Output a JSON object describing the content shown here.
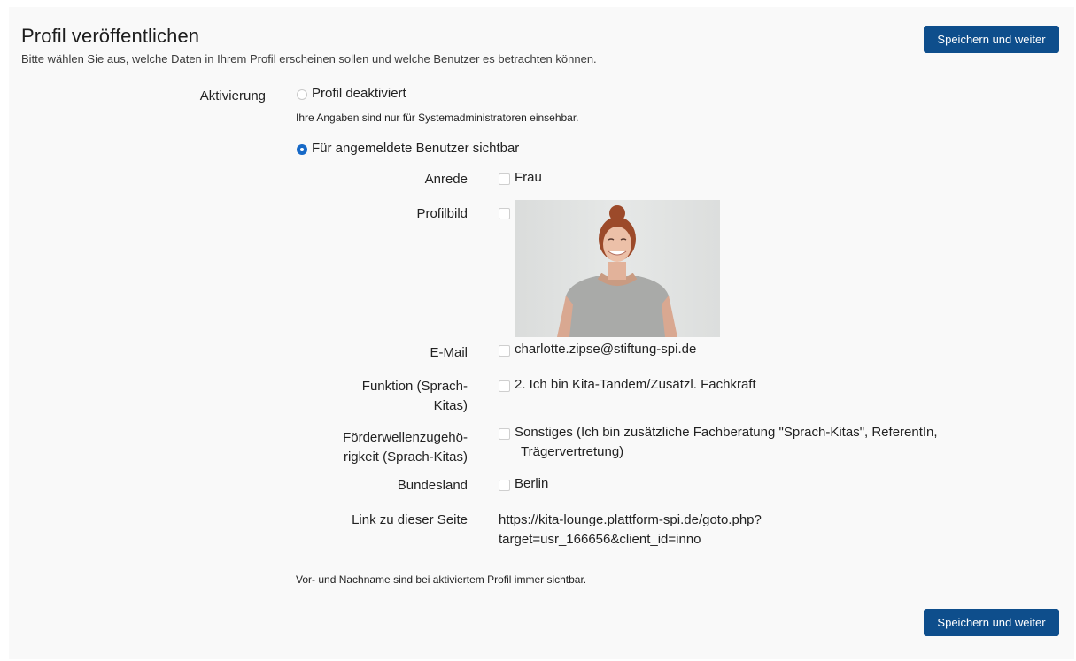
{
  "header": {
    "title": "Profil veröffentlichen",
    "subtitle": "Bitte wählen Sie aus, welche Daten in Ihrem Profil erscheinen sollen und welche Benutzer es betrachten können.",
    "save_label": "Speichern und weiter"
  },
  "activation": {
    "label": "Aktivierung",
    "option_disabled": "Profil deaktiviert",
    "option_disabled_info": "Ihre Angaben sind nur für Systemadministratoren einsehbar.",
    "option_visible": "Für angemeldete Benutzer sichtbar",
    "selected": "visible"
  },
  "fields": {
    "anrede": {
      "label": "Anrede",
      "value": "Frau"
    },
    "profilbild": {
      "label": "Profilbild"
    },
    "email": {
      "label": "E-Mail",
      "value": "charlotte.zipse@stiftung-spi.de"
    },
    "funktion": {
      "label_line1": "Funktion (Sprach-",
      "label_line2": "Kitas)",
      "value": "2. Ich bin Kita-Tandem/Zusätzl. Fachkraft"
    },
    "foerderwelle": {
      "label_line1": "Förderwellenzugehö-",
      "label_line2": "rigkeit (Sprach-Kitas)",
      "value_line1": "Sonstiges (Ich bin zusätzliche Fachberatung \"Sprach-Kitas\", ReferentIn,",
      "value_line2": "Trägervertretung)"
    },
    "bundesland": {
      "label": "Bundesland",
      "value": "Berlin"
    },
    "link": {
      "label": "Link zu dieser Seite",
      "value_line1": "https://kita-lounge.plattform-spi.de/goto.php?",
      "value_line2": "target=usr_166656&client_id=inno"
    }
  },
  "footer_note": "Vor- und Nachname sind bei aktiviertem Profil immer sichtbar.",
  "colors": {
    "button": "#0e4e8c",
    "radio_checked": "#1769c7",
    "panel": "#f9f9f9"
  }
}
